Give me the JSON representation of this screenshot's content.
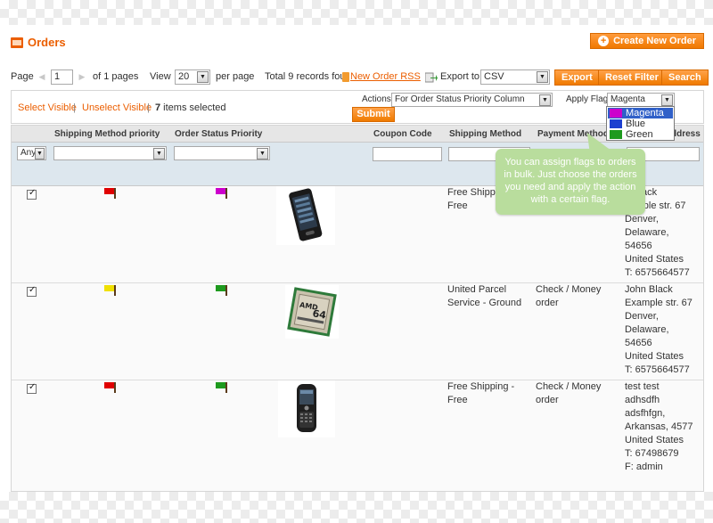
{
  "page": {
    "title": "Orders",
    "create_button": "Create New Order",
    "icons": {
      "title": "orders-icon",
      "create": "plus-icon"
    }
  },
  "pager": {
    "page_label": "Page",
    "page_value": "1",
    "of_pages": "of 1 pages",
    "view_label": "View",
    "view_value": "20",
    "per_page": "per page",
    "total": "Total 9 records fou",
    "rss_link": "New Order RSS",
    "export_label": "Export to:",
    "export_value": "CSV",
    "export_button": "Export",
    "reset_button": "Reset Filter",
    "search_button": "Search"
  },
  "massaction": {
    "select_visible": "Select Visible",
    "separator": "|",
    "unselect_visible": "Unselect Visible",
    "selected_count": "7",
    "selected_text": " items selected",
    "actions_label": "Actions",
    "actions_value": "For Order Status Priority Column",
    "apply_flag_label": "Apply Flag",
    "apply_flag_value": "Magenta",
    "submit_button": "Submit"
  },
  "flag_dropdown": {
    "options": [
      {
        "label": "Magenta",
        "color": "#cc00cc",
        "selected": true
      },
      {
        "label": "Blue",
        "color": "#1c3fd0",
        "selected": false
      },
      {
        "label": "Green",
        "color": "#1e9a1e",
        "selected": false
      }
    ]
  },
  "grid": {
    "headers": {
      "shipping_priority": "Shipping Method priority",
      "status_priority": "Order Status Priority",
      "coupon": "Coupon Code",
      "shipping_method": "Shipping Method",
      "payment_method": "Payment Method",
      "address": "ddress"
    },
    "massaction_filter": "Any",
    "rows": [
      {
        "checked": true,
        "shipping_flag": "#e00000",
        "status_flag": "#cc00cc",
        "product_icon": "smartphone-icon",
        "coupon": "",
        "shipping_method": "Free Shippi\nFree",
        "payment_method": "",
        "address": "n Black\nxample str. 67\nDenver, Delaware,\n54656\nUnited States\nT: 6575664577"
      },
      {
        "checked": true,
        "shipping_flag": "#f0e000",
        "status_flag": "#1e9a1e",
        "product_icon": "amd-processor-icon",
        "coupon": "",
        "shipping_method": "United Parcel\nService - Ground",
        "payment_method": "Check / Money\norder",
        "address": "John Black\nExample str. 67\nDenver, Delaware,\n54656\nUnited States\nT: 6575664577"
      },
      {
        "checked": true,
        "shipping_flag": "#e00000",
        "status_flag": "#1e9a1e",
        "product_icon": "blackberry-phone-icon",
        "coupon": "",
        "shipping_method": "Free Shipping -\nFree",
        "payment_method": "Check / Money\norder",
        "address": "test test\nadhsdfh\nadsfhfgn,\nArkansas, 4577\nUnited States\nT: 67498679\nF: admin"
      }
    ]
  },
  "tooltip": {
    "text": "You can assign flags to orders in bulk. Just choose the orders you need and apply the action with a certain flag."
  }
}
